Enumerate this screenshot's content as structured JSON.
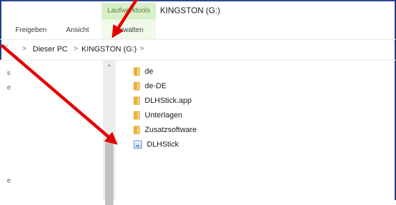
{
  "ribbon": {
    "context_tab_label": "Laufwerktools",
    "window_title": "KINGSTON (G:)",
    "tabs": [
      {
        "label": "Freigeben"
      },
      {
        "label": "Ansicht"
      },
      {
        "label": "Verwalten"
      }
    ]
  },
  "address_bar": {
    "separator": ">",
    "path": [
      "Dieser PC",
      "KINGSTON (G:)"
    ]
  },
  "nav_pane": {
    "scroll_up_glyph": "^",
    "marks": [
      "s",
      "e",
      "e"
    ]
  },
  "files": [
    {
      "name": "de",
      "type": "folder"
    },
    {
      "name": "de-DE",
      "type": "folder"
    },
    {
      "name": "DLHStick.app",
      "type": "folder"
    },
    {
      "name": "Unterlagen",
      "type": "folder"
    },
    {
      "name": "Zusatzsoftware",
      "type": "folder"
    },
    {
      "name": "DLHStick",
      "type": "application"
    }
  ],
  "colors": {
    "annotation_arrow": "#e40000",
    "context_tab_bg": "#d7f0c9",
    "folder": "#e6b23c",
    "frame": "#1f3f86"
  }
}
